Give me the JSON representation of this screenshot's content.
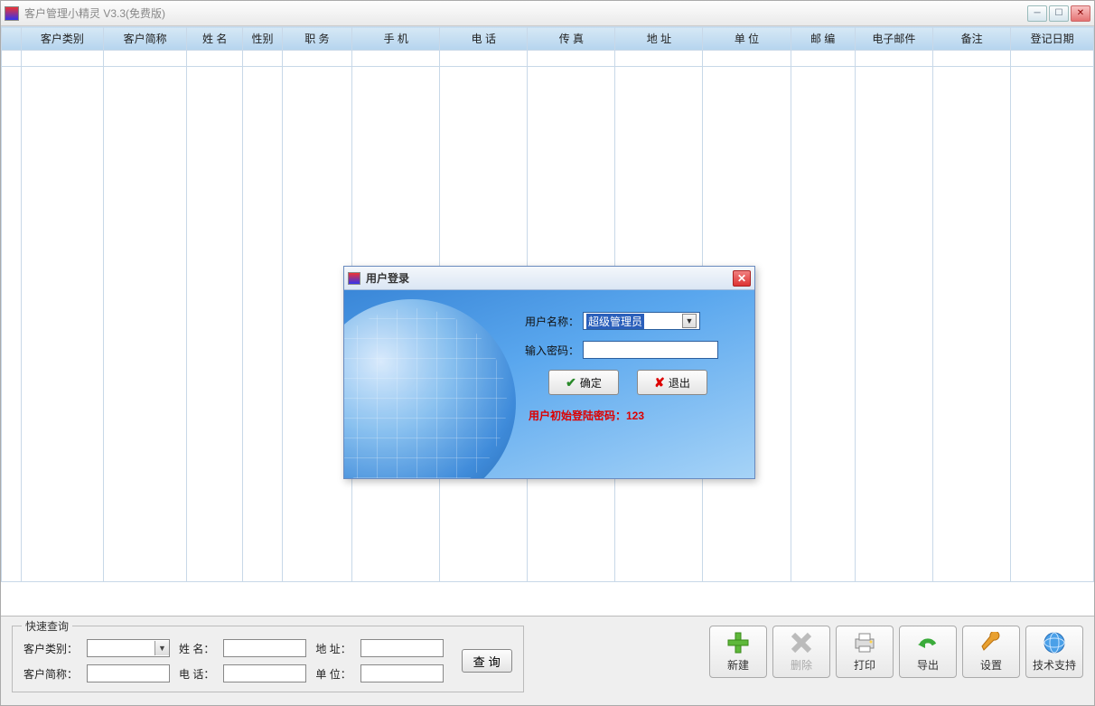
{
  "window": {
    "title": "客户管理小精灵 V3.3(免费版)"
  },
  "grid": {
    "columns": [
      "客户类别",
      "客户简称",
      "姓  名",
      "性别",
      "职    务",
      "手    机",
      "电    话",
      "传    真",
      "地    址",
      "单    位",
      "邮    编",
      "电子邮件",
      "备注",
      "登记日期"
    ],
    "widths": [
      85,
      85,
      58,
      40,
      72,
      90,
      90,
      90,
      90,
      90,
      66,
      80,
      80,
      85
    ]
  },
  "quick_search": {
    "legend": "快速查询",
    "labels": {
      "category": "客户类别：",
      "name": "姓  名：",
      "address": "地  址：",
      "short": "客户简称：",
      "phone": "电  话：",
      "unit": "单  位："
    },
    "search_btn": "查 询"
  },
  "toolbar": {
    "new": "新建",
    "delete": "删除",
    "print": "打印",
    "export": "导出",
    "settings": "设置",
    "support": "技术支持"
  },
  "login": {
    "title": "用户登录",
    "username_label": "用户名称：",
    "username_value": "超级管理员",
    "password_label": "输入密码：",
    "ok": "确定",
    "exit": "退出",
    "hint": "用户初始登陆密码：123"
  }
}
